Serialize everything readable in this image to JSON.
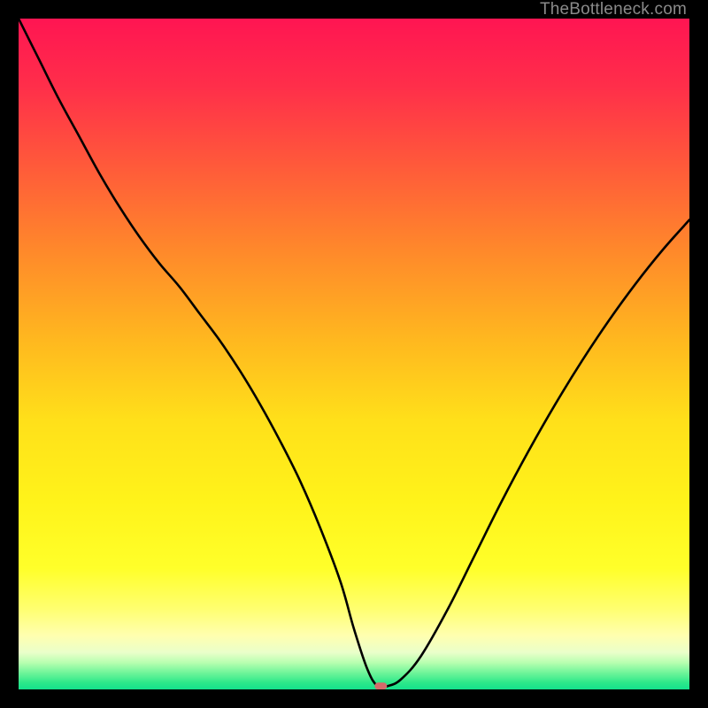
{
  "watermark": "TheBottleneck.com",
  "chart_data": {
    "type": "line",
    "title": "",
    "xlabel": "",
    "ylabel": "",
    "xlim": [
      0,
      100
    ],
    "ylim": [
      0,
      100
    ],
    "series": [
      {
        "name": "bottleneck-curve",
        "x": [
          0,
          3,
          6,
          9,
          12,
          15,
          18,
          21,
          24,
          27,
          30,
          33,
          36,
          39,
          42,
          45,
          48,
          50,
          52,
          53.5,
          55,
          57,
          60,
          64,
          68,
          72,
          76,
          80,
          84,
          88,
          92,
          96,
          100
        ],
        "values": [
          100,
          94,
          88,
          82.5,
          77,
          72,
          67.5,
          63.5,
          60,
          56,
          52,
          47.5,
          42.5,
          37,
          31,
          24,
          16,
          9,
          3,
          0.5,
          0.5,
          1.5,
          5,
          12,
          20,
          28,
          35.5,
          42.5,
          49,
          55,
          60.5,
          65.5,
          70
        ]
      }
    ],
    "marker": {
      "x": 54,
      "y": 0.5,
      "color": "#d46a6a"
    },
    "gradient_stops": [
      {
        "pos": 0.0,
        "color": "#ff1552"
      },
      {
        "pos": 0.1,
        "color": "#ff2e4a"
      },
      {
        "pos": 0.22,
        "color": "#ff5a3a"
      },
      {
        "pos": 0.35,
        "color": "#ff8a2a"
      },
      {
        "pos": 0.48,
        "color": "#ffb81f"
      },
      {
        "pos": 0.6,
        "color": "#ffe01a"
      },
      {
        "pos": 0.72,
        "color": "#fff31a"
      },
      {
        "pos": 0.82,
        "color": "#ffff2a"
      },
      {
        "pos": 0.88,
        "color": "#ffff70"
      },
      {
        "pos": 0.92,
        "color": "#ffffb0"
      },
      {
        "pos": 0.945,
        "color": "#eaffca"
      },
      {
        "pos": 0.96,
        "color": "#b8ffb0"
      },
      {
        "pos": 0.975,
        "color": "#70f59a"
      },
      {
        "pos": 0.99,
        "color": "#2de88a"
      },
      {
        "pos": 1.0,
        "color": "#14e18c"
      }
    ]
  }
}
